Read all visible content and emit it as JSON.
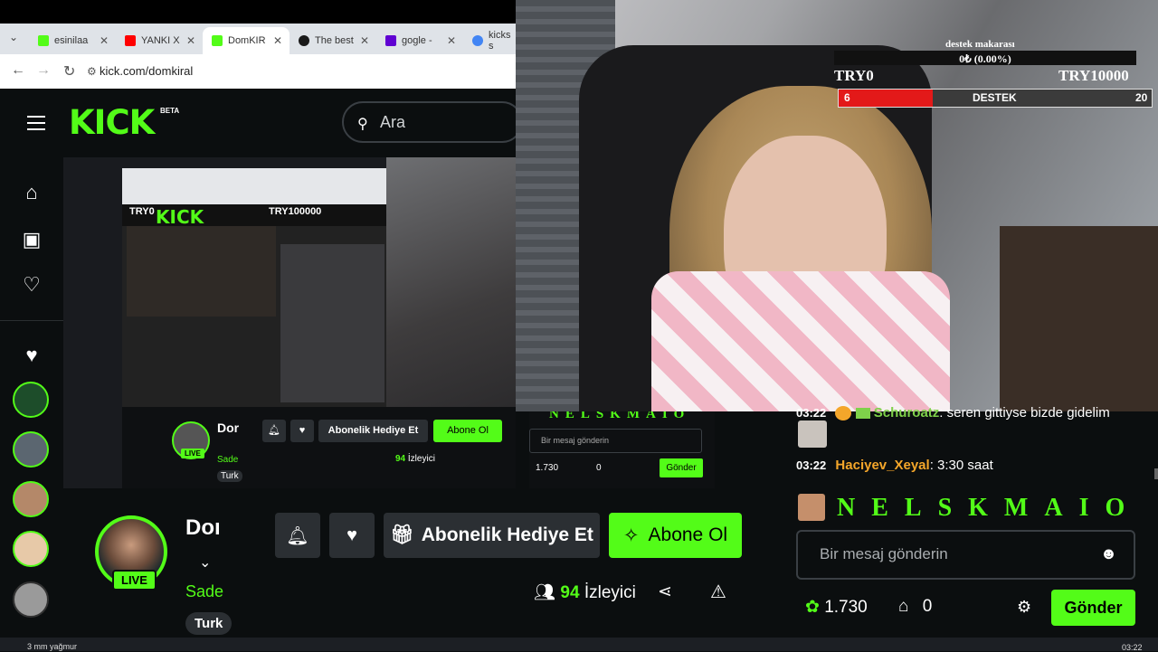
{
  "browser": {
    "tabs": [
      {
        "label": "esinilaa",
        "favicon_color": "#53fc18"
      },
      {
        "label": "YANKI X",
        "favicon_color": "#ff0000"
      },
      {
        "label": "DomKIR",
        "favicon_color": "#53fc18",
        "active": true
      },
      {
        "label": "The best",
        "favicon_color": "#1a1a1a"
      },
      {
        "label": "gogle -",
        "favicon_color": "#6001d2"
      },
      {
        "label": "kicks s",
        "favicon_color": "#4285f4"
      }
    ],
    "url": "kick.com/domkiral"
  },
  "header": {
    "logo": "KICK",
    "beta": "BETA",
    "search_placeholder": "Ara"
  },
  "sidebar": {
    "icons": [
      "home-icon",
      "browse-icon",
      "following-icon"
    ],
    "followed_icon": "heart-icon"
  },
  "inner_stream": {
    "goal_min": "TRY0",
    "goal_max": "TRY100000",
    "logo": "KICK",
    "channel_name": "Dor",
    "category": "Sade",
    "tag": "Turk",
    "gift_label": "Abonelik Hediye Et",
    "subscribe_label": "Abone Ol",
    "viewers_count": "94",
    "viewers_label": "İzleyici",
    "chat_placeholder": "Bir mesaj gönderin",
    "points": "1.730",
    "store": "0",
    "send_label": "Gönder",
    "chat_user": "NELSKMAIO"
  },
  "goal": {
    "title": "destek makarası",
    "amount": "0₺ (0.00%)",
    "min_label": "TRY0",
    "max_label": "TRY10000",
    "current": "6",
    "bar_label": "DESTEK",
    "target": "20",
    "progress": 0.3
  },
  "chat": {
    "messages": [
      {
        "time": "03:22",
        "user": "Schuroatz",
        "user_color": "#7fd14a",
        "text": "seren gittiyse bizde gidelim"
      },
      {
        "time": "03:22",
        "user": "Haciyev_Xeyal",
        "user_color": "#f4a62a",
        "text": "3:30 saat"
      }
    ],
    "banner_user": "NELSKMAIO",
    "input_placeholder": "Bir mesaj gönderin",
    "points": "1.730",
    "store_count": "0",
    "send_label": "Gönder"
  },
  "channel": {
    "name": "Doı",
    "live_label": "LIVE",
    "category": "Sade",
    "tag": "Turk",
    "gift_label": "Abonelik Hediye Et",
    "subscribe_label": "Abone Ol",
    "viewers_count": "94",
    "viewers_label": "İzleyici"
  },
  "taskbar": {
    "weather": "3 mm yağmur",
    "clock": "03:22"
  }
}
